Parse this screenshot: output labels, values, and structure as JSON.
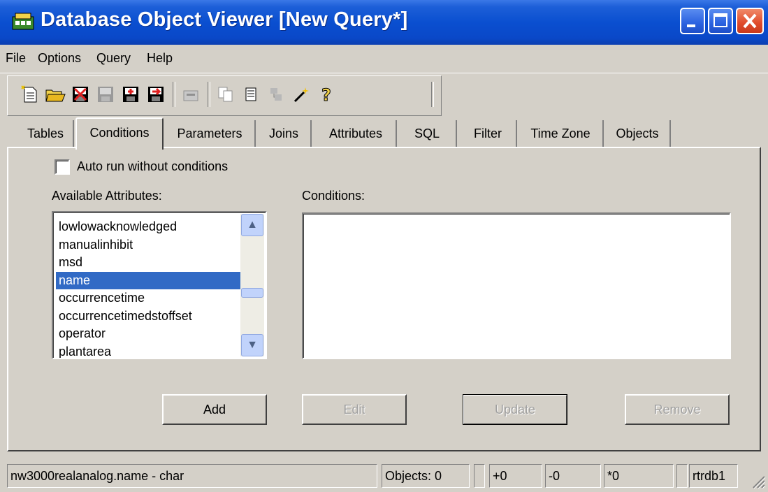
{
  "window": {
    "title": "Database Object Viewer [New Query*]"
  },
  "titlebar_buttons": {
    "minimize": "minimize-icon",
    "maximize": "maximize-icon",
    "close": "close-icon",
    "close_color": "#e04a2a"
  },
  "menu": {
    "items": [
      "File",
      "Options",
      "Query",
      "Help"
    ]
  },
  "toolbar": {
    "icons": [
      "new-query-icon",
      "open-folder-icon",
      "delete-icon",
      "save-icon",
      "save-as-icon",
      "export-icon",
      "run-icon",
      "copy-icon",
      "list-icon",
      "objects-icon",
      "wizard-icon",
      "help-icon"
    ]
  },
  "tabs": {
    "items": [
      "Tables",
      "Conditions",
      "Parameters",
      "Joins",
      "Attributes",
      "SQL",
      "Filter",
      "Time Zone",
      "Objects"
    ],
    "active": "Conditions"
  },
  "conditions_tab": {
    "auto_run_label": "Auto run without conditions",
    "auto_run_checked": false,
    "available_attributes_label": "Available Attributes:",
    "conditions_label": "Conditions:",
    "available_attributes": [
      "lowlowacknowledged",
      "manualinhibit",
      "msd",
      "name",
      "occurrencetime",
      "occurrencetimedstoffset",
      "operator",
      "plantarea"
    ],
    "selected_attribute": "name",
    "conditions": []
  },
  "buttons": {
    "add": "Add",
    "edit": "Edit",
    "update": "Update",
    "remove": "Remove"
  },
  "statusbar": {
    "field": "nw3000realanalog.name - char",
    "objects": "Objects: 0",
    "plus": "+0",
    "minus": "-0",
    "star": "*0",
    "db": "rtrdb1"
  },
  "colors": {
    "titlebar": "#0a4fd0",
    "selection": "#316ac5",
    "face": "#d4d0c8"
  }
}
